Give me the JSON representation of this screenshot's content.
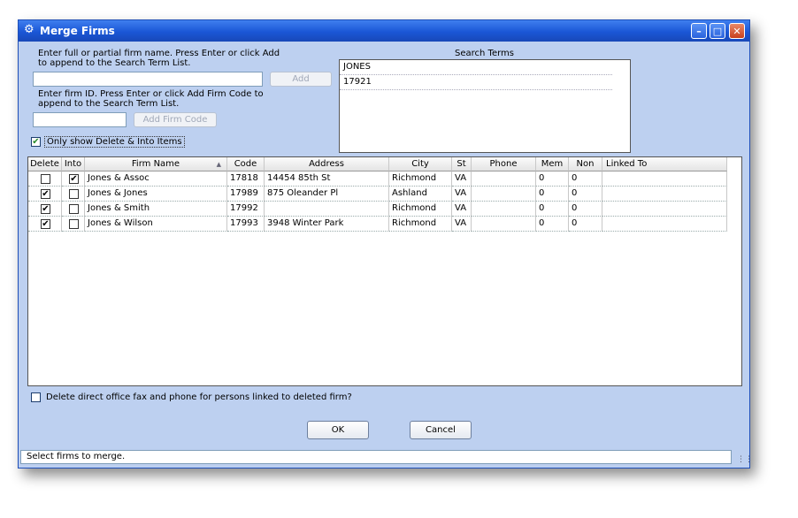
{
  "window": {
    "title": "Merge Firms"
  },
  "search": {
    "name_instructions": "Enter full or partial firm name.  Press Enter or click Add\nto append to the Search Term List.",
    "name_value": "",
    "add_label": "Add",
    "id_instructions": "Enter firm ID.  Press Enter or click Add Firm Code to\nappend to the Search Term List.",
    "id_value": "",
    "add_code_label": "Add Firm Code",
    "only_show_label": "Only show Delete & Into Items",
    "only_show_checked": true
  },
  "search_terms": {
    "title": "Search Terms",
    "items": [
      "JONES",
      "17921"
    ]
  },
  "grid": {
    "columns": [
      "Delete",
      "Into",
      "Firm Name",
      "Code",
      "Address",
      "City",
      "St",
      "Phone",
      "Mem",
      "Non",
      "Linked To"
    ],
    "rows": [
      {
        "delete": false,
        "into": true,
        "name": "Jones & Assoc",
        "code": "17818",
        "address": "14454 85th St",
        "city": "Richmond",
        "st": "VA",
        "phone": "",
        "mem": "0",
        "non": "0",
        "linked": ""
      },
      {
        "delete": true,
        "into": false,
        "name": "Jones & Jones",
        "code": "17989",
        "address": "875 Oleander Pl",
        "city": "Ashland",
        "st": "VA",
        "phone": "",
        "mem": "0",
        "non": "0",
        "linked": ""
      },
      {
        "delete": true,
        "into": false,
        "name": "Jones & Smith",
        "code": "17992",
        "address": "",
        "city": "Richmond",
        "st": "VA",
        "phone": "",
        "mem": "0",
        "non": "0",
        "linked": ""
      },
      {
        "delete": true,
        "into": false,
        "name": "Jones & Wilson",
        "code": "17993",
        "address": "3948 Winter Park",
        "city": "Richmond",
        "st": "VA",
        "phone": "",
        "mem": "0",
        "non": "0",
        "linked": ""
      }
    ]
  },
  "options": {
    "delete_fax_label": "Delete direct office fax and phone for persons linked to deleted firm?",
    "delete_fax_checked": false
  },
  "buttons": {
    "ok": "OK",
    "cancel": "Cancel"
  },
  "status": {
    "text": "Select firms to merge."
  },
  "icons": {
    "window": "gear-icon",
    "sort": "sort-ascending-icon",
    "check": "checkmark-icon"
  }
}
